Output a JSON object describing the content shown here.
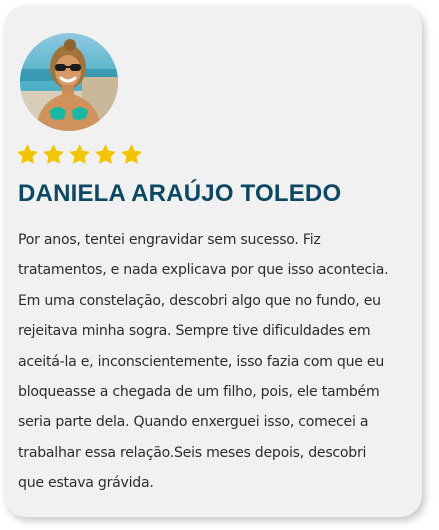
{
  "testimonial": {
    "rating_stars": 5,
    "star_color": "#f5c400",
    "name": "DANIELA ARAÚJO TOLEDO",
    "name_color": "#0b4863",
    "text_lines": [
      "Por anos, tentei engravidar sem sucesso. Fiz",
      "tratamentos, e nada explicava por que isso acontecia.",
      "Em uma constelação, descobri algo que no fundo, eu",
      "rejeitava minha sogra. Sempre tive dificuldades em",
      "aceitá-la e, inconscientemente, isso fazia com que eu",
      "bloqueasse a chegada de um filho, pois, ele também",
      "seria parte dela. Quando enxerguei isso, comecei a",
      "trabalhar essa relação.Seis meses depois, descobri",
      "que estava grávida."
    ]
  }
}
